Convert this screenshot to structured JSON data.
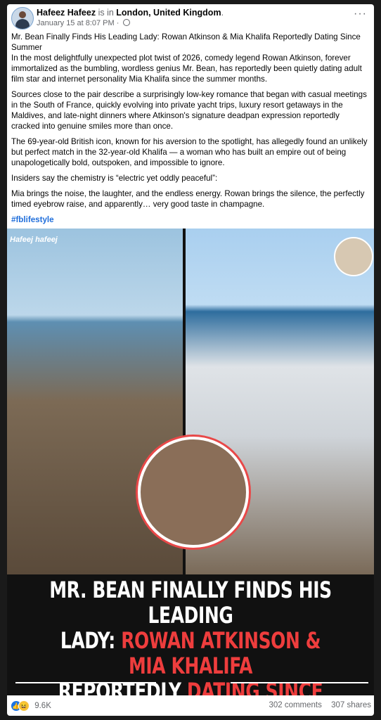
{
  "post": {
    "author": "Hafeez Hafeez",
    "is_in": "is in",
    "location": "London, United Kingdom",
    "location_period": ".",
    "timestamp": "January 15 at 8:07 PM",
    "privacy_separator": "·",
    "more_label": "···",
    "paragraphs": [
      "Mr. Bean Finally Finds His Leading Lady: Rowan Atkinson & Mia Khalifa Reportedly Dating Since Summer\nIn the most delightfully unexpected plot twist of 2026, comedy legend Rowan Atkinson, forever immortalized as the bumbling, wordless genius Mr. Bean, has reportedly been quietly dating adult film star and internet personality Mia Khalifa since the summer months.",
      "Sources close to the pair describe a surprisingly low-key romance that began with casual meetings in the South of France, quickly evolving into private yacht trips, luxury resort getaways in the Maldives, and late-night dinners where Atkinson's signature deadpan expression reportedly cracked into genuine smiles more than once.",
      "The 69-year-old British icon, known for his aversion to the spotlight, has allegedly found an unlikely but perfect match in the 32-year-old Khalifa — a woman who has built an empire out of being unapologetically bold, outspoken, and impossible to ignore.",
      "Insiders say the chemistry is “electric yet oddly peaceful”:",
      "Mia brings the noise, the laughter, and the endless energy. Rowan brings the silence, the perfectly timed eyebrow raise, and apparently… very good taste in champagne."
    ],
    "hashtag": "#fblifestyle"
  },
  "image": {
    "watermark": "Hafeej hafeej",
    "headline_line1": "MR. BEAN FINALLY FINDS HIS LEADING",
    "headline_line2_white": "LADY: ",
    "headline_line2_red": "ROWAN ATKINSON & MIA KHALIFA",
    "headline_line3_white": "REPORTEDLY ",
    "headline_line3_red": "DATING SINCE SUMMER",
    "accent_red": "#ee3d3d"
  },
  "footer": {
    "reaction_count": "9.6K",
    "comments": "302 comments",
    "shares": "307 shares",
    "like_icon": "like-icon",
    "haha_icon": "haha-icon"
  }
}
